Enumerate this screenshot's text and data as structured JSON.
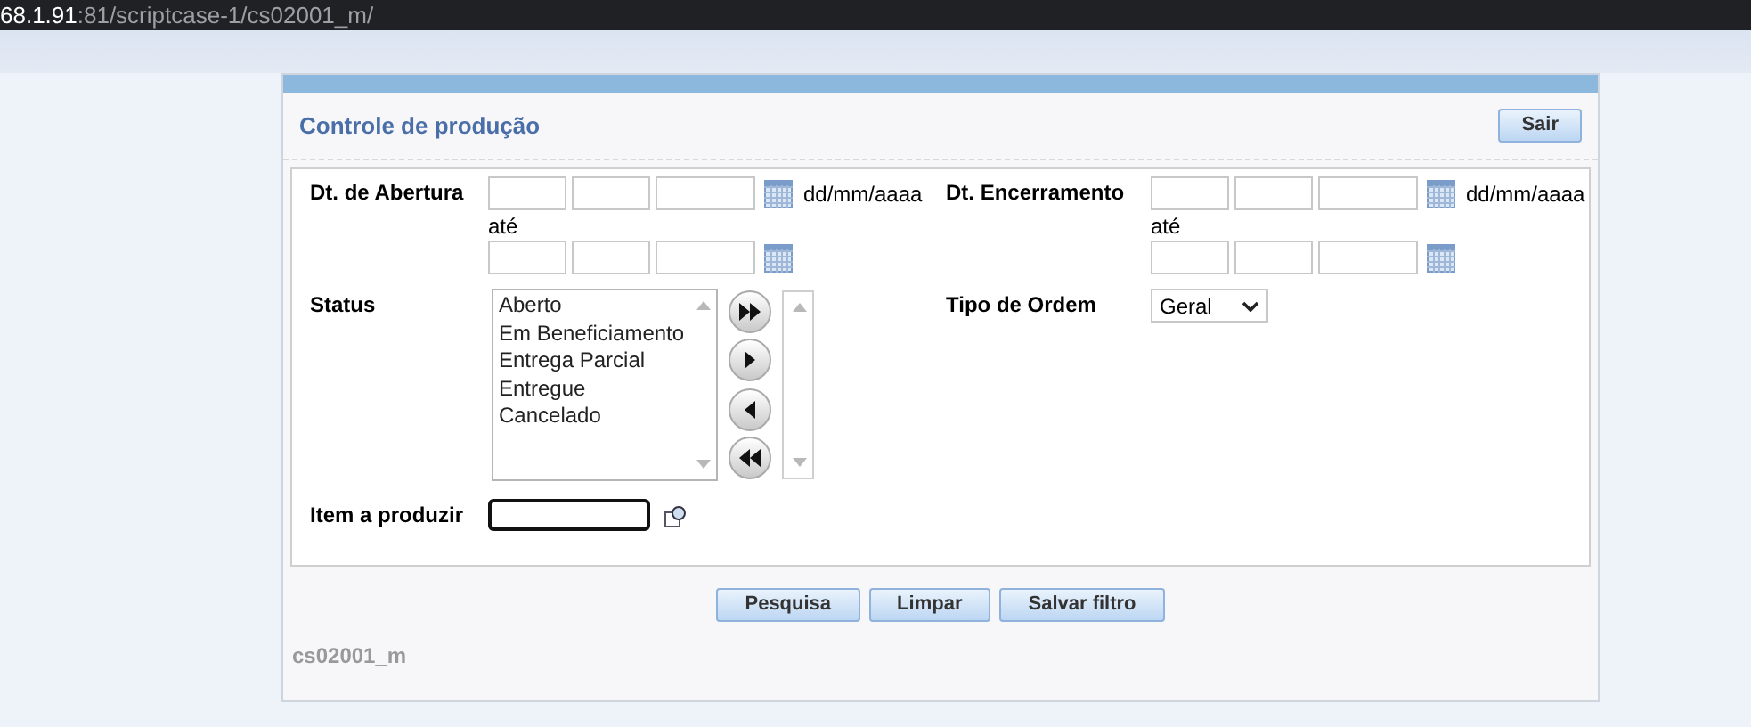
{
  "address_bar": {
    "host": "68.1.91",
    "path": ":81/scriptcase-1/cs02001_m/"
  },
  "form": {
    "title": "Controle de produção",
    "exit_button": "Sair",
    "date_filters": [
      {
        "label": "Dt. de Abertura",
        "format_hint": "dd/mm/aaaa",
        "range_word": "até"
      },
      {
        "label": "Dt. Encerramento",
        "format_hint": "dd/mm/aaaa",
        "range_word": "até"
      }
    ],
    "status": {
      "label": "Status",
      "options": [
        "Aberto",
        "Em Beneficiamento",
        "Entrega Parcial",
        "Entregue",
        "Cancelado"
      ]
    },
    "order_type": {
      "label": "Tipo de Ordem",
      "value": "Geral"
    },
    "item": {
      "label": "Item a produzir"
    },
    "buttons": [
      "Pesquisa",
      "Limpar",
      "Salvar filtro"
    ],
    "footer": "cs02001_m"
  }
}
